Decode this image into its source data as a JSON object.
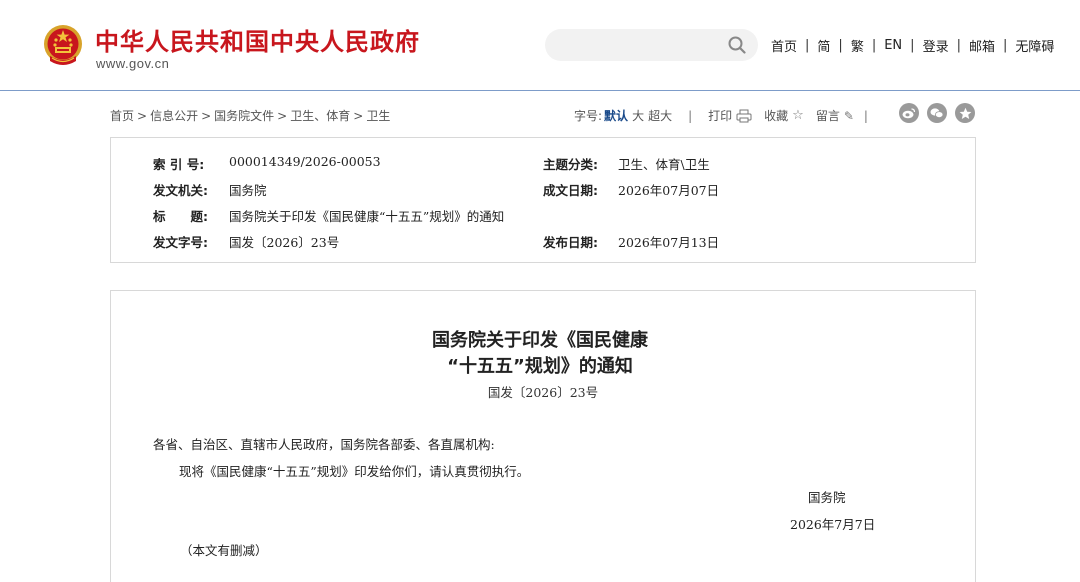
{
  "header": {
    "site_title": "中华人民共和国中央人民政府",
    "site_url": "www.gov.cn",
    "search_placeholder": "",
    "nav": [
      "首页",
      "简",
      "繁",
      "EN",
      "登录",
      "邮箱",
      "无障碍"
    ]
  },
  "breadcrumb": [
    "首页",
    "信息公开",
    "国务院文件",
    "卫生、体育",
    "卫生"
  ],
  "tools": {
    "font_label": "字号:",
    "font_default": "默认",
    "font_large": "大",
    "font_xlarge": "超大",
    "print": "打印",
    "favorite": "收藏",
    "comment": "留言"
  },
  "share_icons": [
    "weibo-icon",
    "wechat-icon",
    "star-icon"
  ],
  "meta": {
    "index_label": "索 引 号:",
    "index_value": "000014349/2026-00053",
    "category_label": "主题分类:",
    "category_value": "卫生、体育\\卫生",
    "issuer_label": "发文机关:",
    "issuer_value": "国务院",
    "written_label": "成文日期:",
    "written_value": "2026年07月07日",
    "title_label": "标　　题:",
    "title_value": "国务院关于印发《国民健康“十五五”规划》的通知",
    "docnum_label": "发文字号:",
    "docnum_value": "国发〔2026〕23号",
    "published_label": "发布日期:",
    "published_value": "2026年07月13日"
  },
  "document": {
    "title_line1": "国务院关于印发《国民健康",
    "title_line2": "“十五五”规划》的通知",
    "doc_number": "国发〔2026〕23号",
    "salutation": "各省、自治区、直辖市人民政府，国务院各部委、各直属机构:",
    "body": "现将《国民健康“十五五”规划》印发给你们，请认真贯彻执行。",
    "signer": "国务院",
    "date": "2026年7月7日",
    "note": "（本文有删减）"
  },
  "colors": {
    "brand_red": "#c8161d",
    "link_blue": "#1a4a8a",
    "header_rule": "#7d9cc9"
  }
}
